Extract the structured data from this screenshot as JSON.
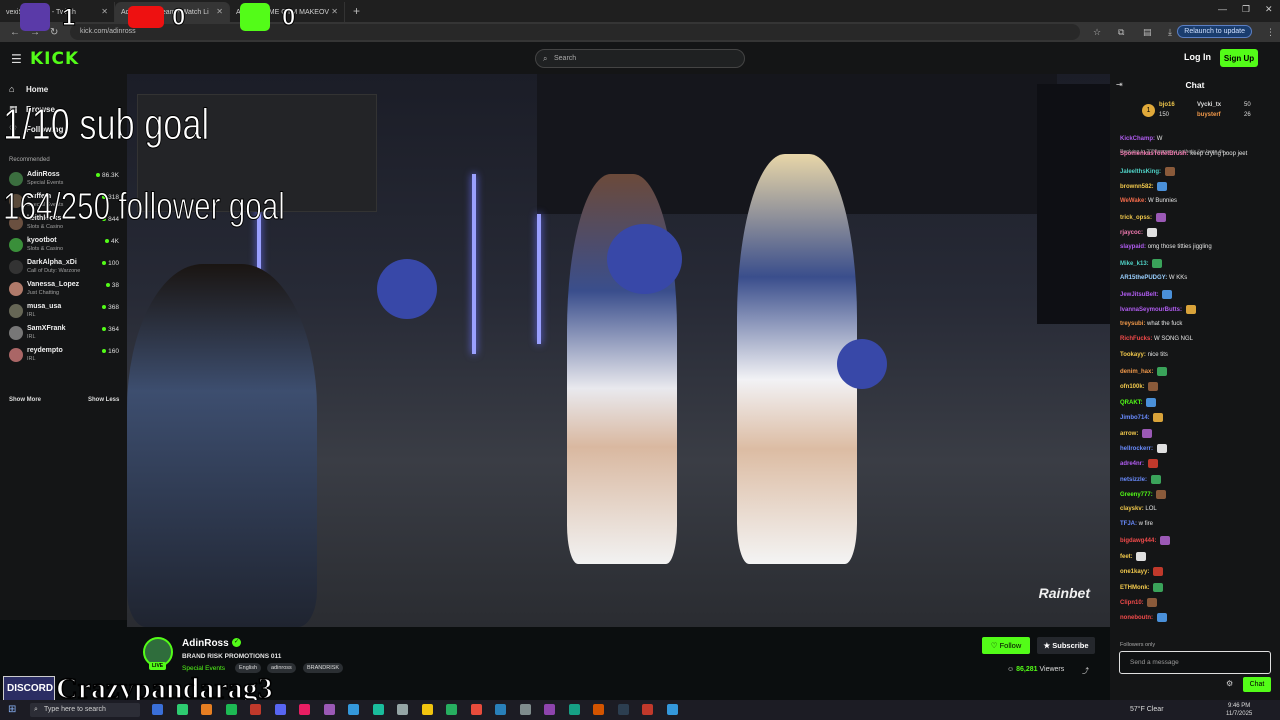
{
  "browser": {
    "tabs": [
      {
        "label": "vexiSanctuary - Twitch"
      },
      {
        "label": "AdinRoss Stream - Watch Li"
      },
      {
        "label": "AM AT HOME GYM MAKEOV"
      }
    ],
    "url": "kick.com/adinross",
    "relaunch_label": "Relaunch to update"
  },
  "overlay": {
    "twitch_count": "1",
    "youtube_count": "0",
    "kick_count": "0",
    "sub_goal": "1/10 sub goal",
    "follower_goal": "164/250 follower goal",
    "discord_label": "DISCORD",
    "discord_name": "Crazypandarag3"
  },
  "header": {
    "logo": "KICK",
    "search_placeholder": "Search",
    "login": "Log In",
    "signup": "Sign Up"
  },
  "sidebar": {
    "nav": [
      {
        "label": "Home"
      },
      {
        "label": "Browse"
      },
      {
        "label": "Following"
      }
    ],
    "recommended_label": "Recommended",
    "channels": [
      {
        "name": "AdinRoss",
        "category": "Special Events",
        "viewers": "86.3K",
        "color": "#3b6e3f"
      },
      {
        "name": "Cuffem",
        "category": "Special Events",
        "viewers": "318",
        "color": "#5a4a3a"
      },
      {
        "name": "keithlocks",
        "category": "Slots & Casino",
        "viewers": "844",
        "color": "#6a5040"
      },
      {
        "name": "kyootbot",
        "category": "Slots & Casino",
        "viewers": "4K",
        "color": "#3a8f3a"
      },
      {
        "name": "DarkAlpha_xDi",
        "category": "Call of Duty: Warzone",
        "viewers": "100",
        "color": "#333"
      },
      {
        "name": "Vanessa_Lopez",
        "category": "Just Chatting",
        "viewers": "38",
        "color": "#b07a6a"
      },
      {
        "name": "musa_usa",
        "category": "IRL",
        "viewers": "368",
        "color": "#665"
      },
      {
        "name": "SamXFrank",
        "category": "IRL",
        "viewers": "364",
        "color": "#777"
      },
      {
        "name": "reydempto",
        "category": "IRL",
        "viewers": "160",
        "color": "#a66"
      }
    ],
    "show_more": "Show More",
    "show_less": "Show Less"
  },
  "video": {
    "watermark": "Rainbet"
  },
  "stream": {
    "streamer": "AdinRoss",
    "title": "BRAND RISK PROMOTIONS 011",
    "category": "Special Events",
    "tags": [
      "English",
      "adinross",
      "BRANDRISK"
    ],
    "follow": "Follow",
    "subscribe": "Subscribe",
    "viewers": "86,281",
    "viewers_label": "Viewers",
    "live_badge": "LIVE"
  },
  "chat": {
    "title": "Chat",
    "leaders": {
      "first": "bjo16",
      "first_count": "150",
      "second": "Vycki_tx",
      "second_count": "50",
      "third": "buysterf",
      "third_count": "26"
    },
    "reply_hint": "Replying to 2055pump: ur pathetic i've been de...",
    "messages": [
      {
        "user": "KickChamp:",
        "text": "W",
        "color": "#b05cf0"
      },
      {
        "user": "SpomenkasToiletBrush:",
        "text": "keep crying poop jeet",
        "color": "#f07ab0"
      },
      {
        "user": "JaleelthsKing:",
        "text": "",
        "color": "#4fd1c5"
      },
      {
        "user": "brownn582:",
        "text": "",
        "color": "#f2c94c"
      },
      {
        "user": "WeWake:",
        "text": "W Bunnies",
        "color": "#f06a4a"
      },
      {
        "user": "trick_opss:",
        "text": "",
        "color": "#f2c94c"
      },
      {
        "user": "rjaycoc:",
        "text": "",
        "color": "#f07ab0"
      },
      {
        "user": "slaypaid:",
        "text": "omg those titties jiggling",
        "color": "#b05cf0"
      },
      {
        "user": "Mike_k13:",
        "text": "",
        "color": "#4fd1c5"
      },
      {
        "user": "AR15thePUDGY:",
        "text": "W KKs",
        "color": "#9ad0ff"
      },
      {
        "user": "JewJitsuBelt:",
        "text": "",
        "color": "#b05cf0"
      },
      {
        "user": "IvannaSeymourButts:",
        "text": "",
        "color": "#b05cf0"
      },
      {
        "user": "treysubi:",
        "text": "what the fuck",
        "color": "#f2994a"
      },
      {
        "user": "RichFucks:",
        "text": "W SONG NGL",
        "color": "#f04a4a"
      },
      {
        "user": "Tookayy:",
        "text": "nice tits",
        "color": "#f2c94c"
      },
      {
        "user": "denim_hax:",
        "text": "",
        "color": "#f2994a"
      },
      {
        "user": "ofn100k:",
        "text": "",
        "color": "#f2c94c"
      },
      {
        "user": "QRAKT:",
        "text": "",
        "color": "#53fc18"
      },
      {
        "user": "Jimbo714:",
        "text": "",
        "color": "#6a8cff"
      },
      {
        "user": "arrow:",
        "text": "",
        "color": "#f2c94c"
      },
      {
        "user": "hellrockerr:",
        "text": "",
        "color": "#6a8cff"
      },
      {
        "user": "adre4nr:",
        "text": "",
        "color": "#b05cf0"
      },
      {
        "user": "netsizzle:",
        "text": "",
        "color": "#6a8cff"
      },
      {
        "user": "Greeny777:",
        "text": "",
        "color": "#53fc18"
      },
      {
        "user": "clayskv:",
        "text": "LOL",
        "color": "#f2c94c"
      },
      {
        "user": "TFJA:",
        "text": "w fire",
        "color": "#6a8cff"
      },
      {
        "user": "bigdawg444:",
        "text": "",
        "color": "#f04a4a"
      },
      {
        "user": "feet:",
        "text": "",
        "color": "#f2c94c"
      },
      {
        "user": "one1kayy:",
        "text": "",
        "color": "#f2c94c"
      },
      {
        "user": "ETHMonk:",
        "text": "",
        "color": "#f2c94c"
      },
      {
        "user": "Clipn10:",
        "text": "",
        "color": "#f04a4a"
      },
      {
        "user": "noneboutn:",
        "text": "",
        "color": "#f04a4a"
      }
    ],
    "followers_only": "Followers only",
    "input_placeholder": "Send a message",
    "send": "Chat"
  },
  "taskbar": {
    "search_placeholder": "Type here to search",
    "weather": "57°F Clear",
    "time": "9:46 PM",
    "date": "11/7/2025"
  }
}
